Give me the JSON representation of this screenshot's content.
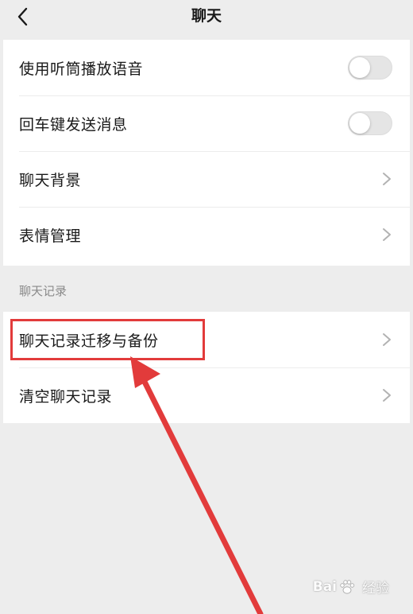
{
  "header": {
    "title": "聊天",
    "back_icon": "chevron-left-icon"
  },
  "settings": {
    "group1": [
      {
        "label": "使用听筒播放语音",
        "control": "toggle",
        "enabled": false
      },
      {
        "label": "回车键发送消息",
        "control": "toggle",
        "enabled": false
      },
      {
        "label": "聊天背景",
        "control": "chevron"
      },
      {
        "label": "表情管理",
        "control": "chevron"
      }
    ],
    "section_title": "聊天记录",
    "group2": [
      {
        "label": "聊天记录迁移与备份",
        "control": "chevron",
        "highlighted": true
      },
      {
        "label": "清空聊天记录",
        "control": "chevron"
      }
    ]
  },
  "annotation": {
    "highlight_color": "#e23b3b",
    "arrow_color": "#e23b3b"
  },
  "watermark": {
    "logo_left": "Bai",
    "logo_right": "经验"
  },
  "colors": {
    "background": "#ededed",
    "card": "#ffffff",
    "text": "#191919",
    "section_text": "#8a8a8a",
    "toggle_off": "#e5e5e5"
  }
}
